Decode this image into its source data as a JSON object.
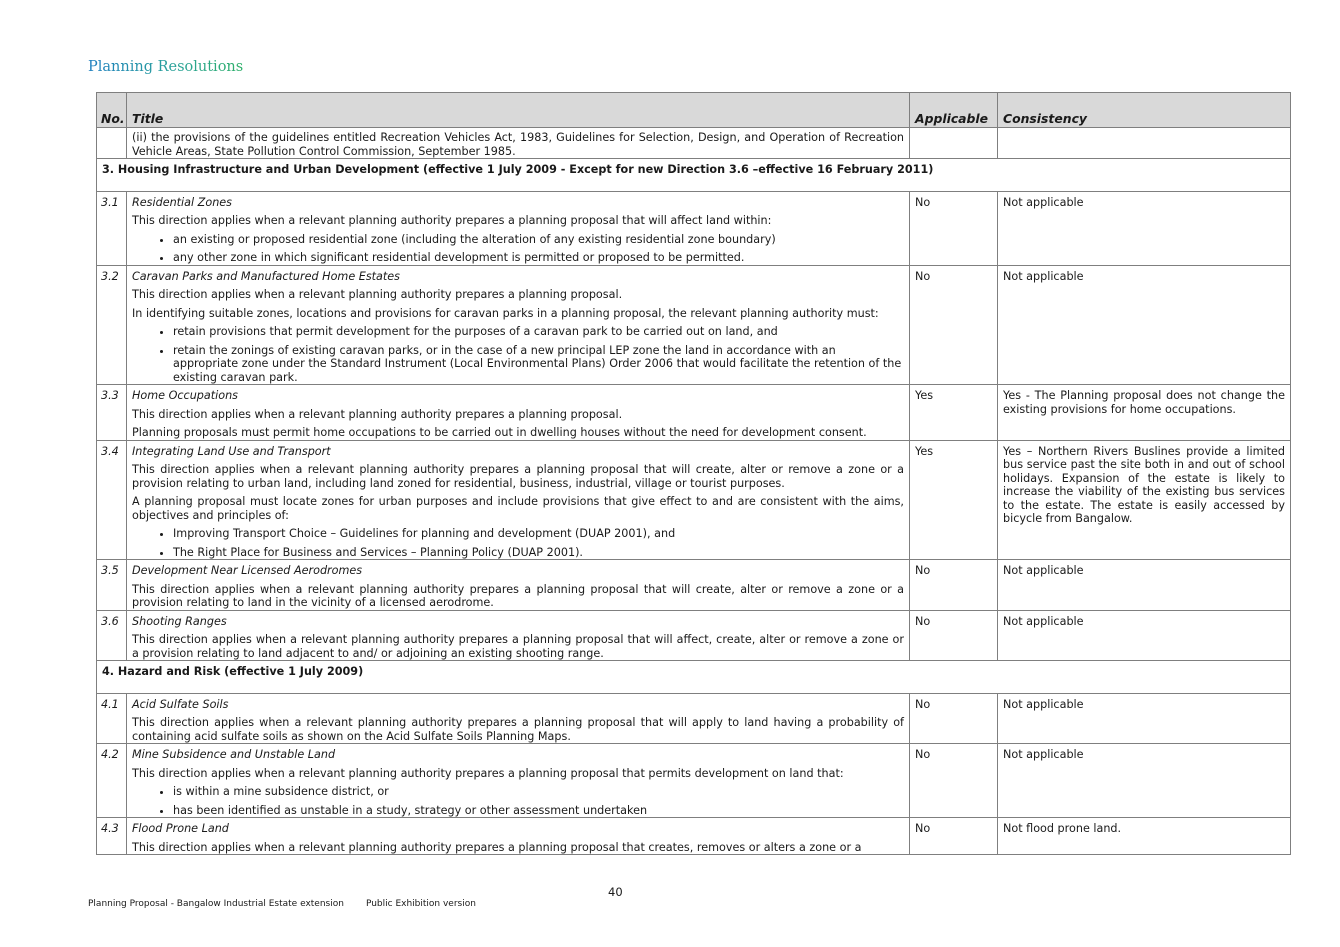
{
  "heading": "Planning Resolutions",
  "columns": {
    "no": "No.",
    "title": "Title",
    "applicable": "Applicable",
    "consistency": "Consistency"
  },
  "continuation": "(ii) the provisions of the guidelines entitled Recreation Vehicles Act, 1983, Guidelines for Selection, Design, and Operation of Recreation Vehicle Areas, State Pollution Control Commission, September 1985.",
  "section3": "3. Housing Infrastructure and Urban Development (effective 1 July 2009 - Except for new Direction 3.6 –effective 16 February 2011)",
  "d31": {
    "no": "3.1",
    "title": "Residential Zones",
    "p1": "This direction applies when a relevant planning authority prepares a planning proposal that will affect land within:",
    "b1": "an existing or proposed residential zone (including the alteration of any existing residential zone boundary)",
    "b2": "any other zone in which significant residential development is permitted or proposed to be permitted.",
    "applicable": "No",
    "consistency": "Not applicable"
  },
  "d32": {
    "no": "3.2",
    "title": "Caravan Parks and Manufactured Home Estates",
    "p1": "This direction applies when a relevant planning authority prepares a planning proposal.",
    "p2": "In identifying suitable zones, locations and provisions for caravan parks in a planning proposal, the relevant planning authority must:",
    "b1": "retain provisions that permit development for the purposes of a caravan park to be carried out on land, and",
    "b2": "retain the zonings of existing caravan parks, or in the case of a new principal LEP zone the land in accordance with an appropriate zone under the Standard Instrument (Local Environmental Plans) Order 2006 that would facilitate the retention of the existing caravan park.",
    "applicable": "No",
    "consistency": "Not applicable"
  },
  "d33": {
    "no": "3.3",
    "title": "Home Occupations",
    "p1": "This direction applies when a relevant planning authority prepares a planning proposal.",
    "p2": "Planning proposals must permit home occupations to be carried out in dwelling houses without the need for development consent.",
    "applicable": "Yes",
    "consistency": "Yes - The Planning proposal does not change the existing provisions for home occupations."
  },
  "d34": {
    "no": "3.4",
    "title": "Integrating Land Use and Transport",
    "p1": "This direction applies when a relevant planning authority prepares a planning proposal that will create, alter or remove a zone or a provision relating to urban land, including land zoned for residential, business, industrial, village or tourist purposes.",
    "p2": "A planning proposal must locate zones for urban purposes and include provisions that give effect to and are consistent with the aims, objectives and principles of:",
    "b1": "Improving Transport Choice – Guidelines for planning and development (DUAP 2001), and",
    "b2": "The Right Place for Business and Services – Planning Policy (DUAP 2001).",
    "applicable": "Yes",
    "consistency": "Yes – Northern Rivers Buslines provide a limited bus service past the site both in and out of school holidays.  Expansion of the estate is likely to increase the viability of the existing bus services to the estate.   The estate is easily accessed by bicycle from Bangalow."
  },
  "d35": {
    "no": "3.5",
    "title": "Development Near Licensed Aerodromes",
    "p1": "This direction applies when a relevant planning authority prepares a planning proposal that will create, alter or remove a zone or a provision relating to land in the vicinity of a licensed aerodrome.",
    "applicable": "No",
    "consistency": "Not applicable"
  },
  "d36": {
    "no": "3.6",
    "title": "Shooting Ranges",
    "p1": "This direction applies when a relevant planning authority prepares a planning proposal that will affect, create, alter or remove a zone or a provision relating to land adjacent to and/ or adjoining an existing shooting range.",
    "applicable": "No",
    "consistency": "Not applicable"
  },
  "section4": "4. Hazard and Risk (effective 1 July 2009)",
  "d41": {
    "no": "4.1",
    "title": "Acid Sulfate Soils",
    "p1": "This direction applies when a relevant planning authority prepares a planning proposal that will apply to land having a probability of containing acid sulfate soils as shown on the Acid Sulfate Soils Planning Maps.",
    "applicable": "No",
    "consistency": "Not applicable"
  },
  "d42": {
    "no": "4.2",
    "title": "Mine Subsidence and Unstable Land",
    "p1": "This direction applies when a relevant planning authority prepares a planning proposal that permits development on land that:",
    "b1": "is within a mine subsidence district, or",
    "b2": "has been identified as unstable in a study, strategy or other assessment undertaken",
    "applicable": "No",
    "consistency": "Not applicable"
  },
  "d43": {
    "no": "4.3",
    "title": "Flood Prone Land",
    "p1": "This direction applies when a relevant planning authority prepares a planning proposal that creates, removes or alters a zone or a",
    "applicable": "No",
    "consistency": "Not flood prone land."
  },
  "page_number": "40",
  "footer": {
    "left": "Planning Proposal - Bangalow Industrial Estate extension",
    "right": "Public Exhibition version"
  }
}
